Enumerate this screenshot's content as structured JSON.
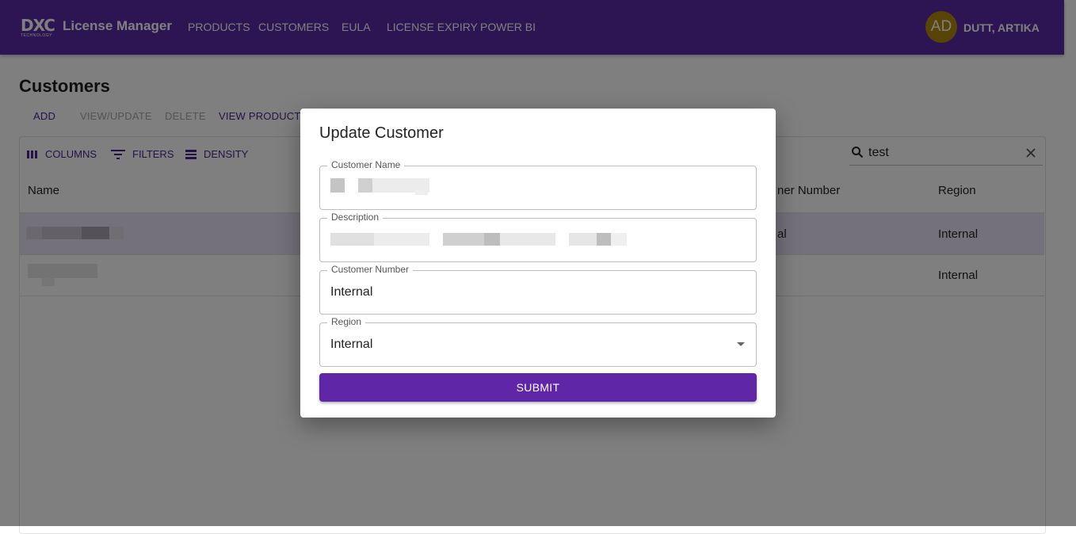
{
  "appbar": {
    "logo_text": "DXC",
    "logo_sub": "TECHNOLOGY",
    "title": "License Manager",
    "nav": [
      "PRODUCTS",
      "CUSTOMERS",
      "EULA",
      "LICENSE EXPIRY",
      "POWER BI"
    ],
    "avatar_initials": "AD",
    "username": "DUTT, ARTIKA",
    "color": "#5b2aa6"
  },
  "page": {
    "title": "Customers",
    "actions": {
      "add": "ADD",
      "view_update": "VIEW/UPDATE",
      "delete": "DELETE",
      "view_products": "VIEW PRODUCTS"
    }
  },
  "grid": {
    "toolbar": {
      "columns": "COLUMNS",
      "filters": "FILTERS",
      "density": "DENSITY"
    },
    "search": {
      "value": "test",
      "icon": "search-icon",
      "clear_icon": "close-icon"
    },
    "headers": {
      "name": "Name",
      "customer_number": "ner Number",
      "region": "Region"
    },
    "rows": [
      {
        "customer_number": "al",
        "region": "Internal",
        "selected": true
      },
      {
        "customer_number": "",
        "region": "Internal",
        "selected": false
      }
    ]
  },
  "dialog": {
    "title": "Update Customer",
    "fields": {
      "customer_name": {
        "label": "Customer Name",
        "value": ""
      },
      "description": {
        "label": "Description",
        "value": ""
      },
      "customer_number": {
        "label": "Customer Number",
        "value": "Internal"
      },
      "region": {
        "label": "Region",
        "value": "Internal"
      }
    },
    "submit_label": "SUBMIT",
    "accent": "#5f26a8"
  }
}
